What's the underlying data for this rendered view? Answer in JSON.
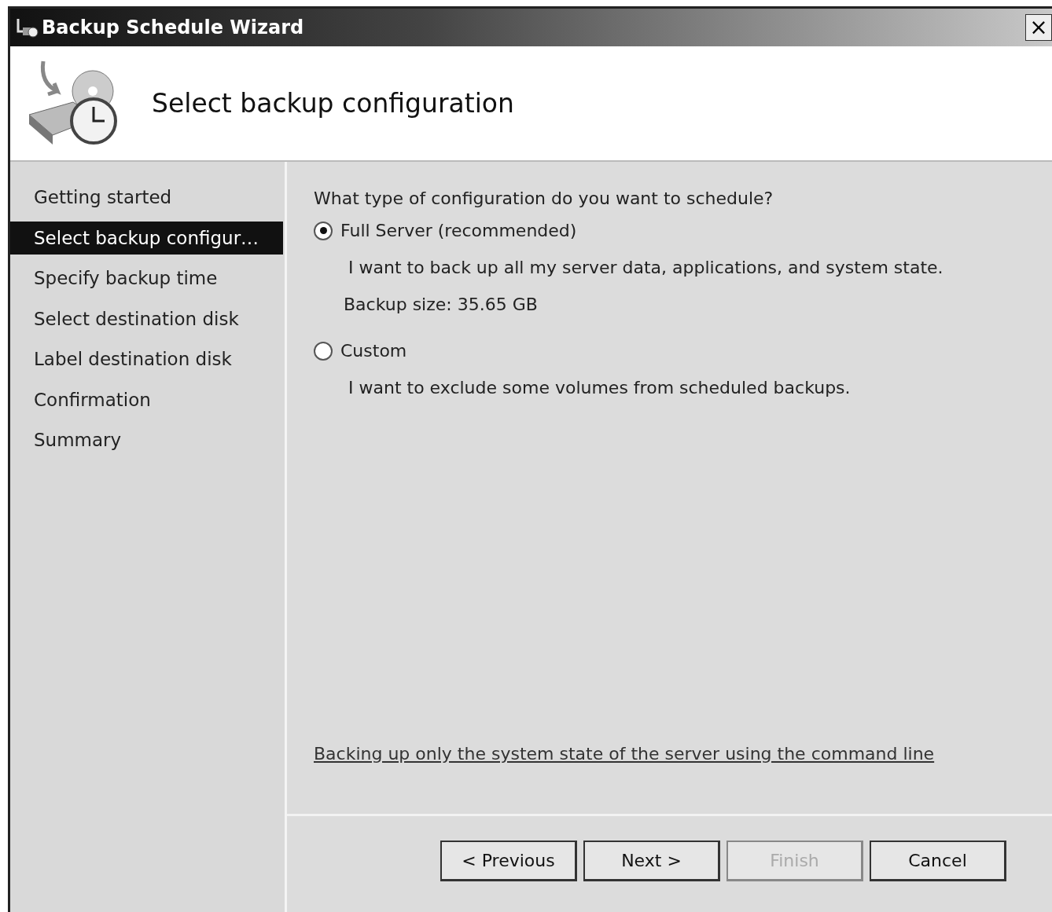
{
  "window": {
    "title": "Backup Schedule Wizard",
    "close": "×"
  },
  "header": {
    "title": "Select backup configuration"
  },
  "steps": [
    {
      "label": "Getting started",
      "selected": false
    },
    {
      "label": "Select backup configur…",
      "selected": true
    },
    {
      "label": "Specify backup time",
      "selected": false
    },
    {
      "label": "Select destination disk",
      "selected": false
    },
    {
      "label": "Label destination disk",
      "selected": false
    },
    {
      "label": "Confirmation",
      "selected": false
    },
    {
      "label": "Summary",
      "selected": false
    }
  ],
  "question": "What type of configuration do you want to schedule?",
  "options": [
    {
      "label": "Full Server (recommended)",
      "selected": true,
      "description": "I want to back up all my server data, applications, and system state.",
      "note": "Backup size: 35.65 GB"
    },
    {
      "label": "Custom",
      "selected": false,
      "description": "I want to exclude some volumes from scheduled backups."
    }
  ],
  "link": "Backing up only the system state of the server using the command line",
  "buttons": [
    {
      "label": "< Previous",
      "disabled": false
    },
    {
      "label": "Next >",
      "disabled": false
    },
    {
      "label": "Finish",
      "disabled": true
    },
    {
      "label": "Cancel",
      "disabled": false
    }
  ]
}
